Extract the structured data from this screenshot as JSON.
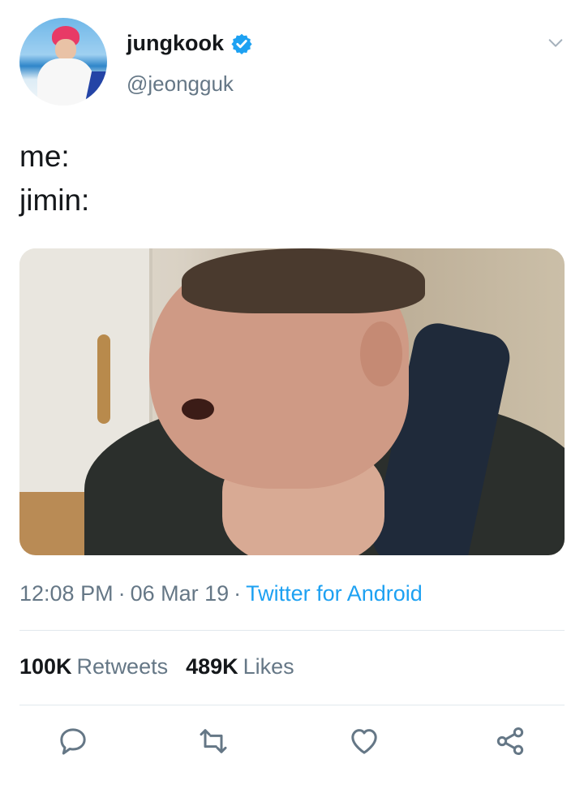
{
  "user": {
    "display_name": "jungkook",
    "handle": "@jeongguk"
  },
  "tweet": {
    "lines": [
      "me:",
      "jimin:"
    ],
    "time": "12:08 PM",
    "date": "06 Mar 19",
    "source": "Twitter for Android",
    "separator": "·"
  },
  "stats": {
    "retweets_count": "100K",
    "retweets_label": "Retweets",
    "likes_count": "489K",
    "likes_label": "Likes"
  },
  "icons": {
    "verified": "verified-badge-icon",
    "caret": "chevron-down-icon",
    "reply": "reply-icon",
    "retweet": "retweet-icon",
    "like": "heart-icon",
    "share": "share-icon"
  },
  "colors": {
    "accent": "#1da1f2",
    "text": "#14171a",
    "secondary": "#657786"
  }
}
